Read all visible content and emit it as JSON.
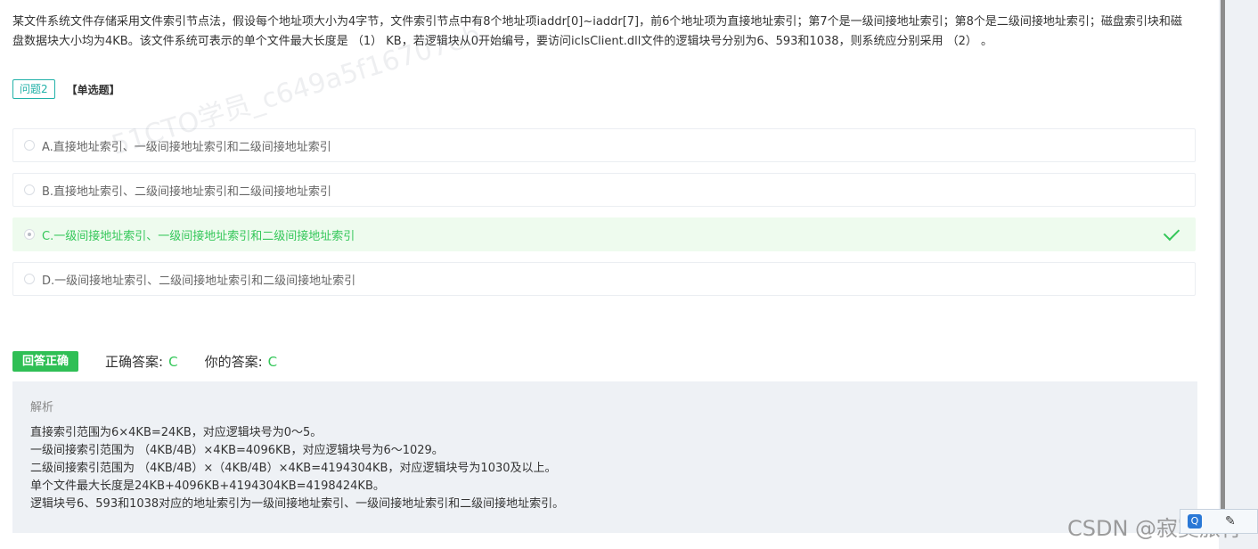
{
  "question": {
    "text": "某文件系统文件存储采用文件索引节点法，假设每个地址项大小为4字节，文件索引节点中有8个地址项iaddr[0]~iaddr[7]，前6个地址项为直接地址索引；第7个是一级间接地址索引；第8个是二级间接地址索引；磁盘索引块和磁盘数据块大小均为4KB。该文件系统可表示的单个文件最大长度是 （1） KB，若逻辑块从0开始编号，要访问iclsClient.dll文件的逻辑块号分别为6、593和1038，则系统应分别采用 （2） 。",
    "tag": "问题2",
    "type": "【单选题】"
  },
  "options": [
    {
      "label": "A.直接地址索引、一级间接地址索引和二级间接地址索引",
      "correct": false
    },
    {
      "label": "B.直接地址索引、二级间接地址索引和二级间接地址索引",
      "correct": false
    },
    {
      "label": "C.一级间接地址索引、一级间接地址索引和二级间接地址索引",
      "correct": true
    },
    {
      "label": "D.一级间接地址索引、二级间接地址索引和二级间接地址索引",
      "correct": false
    }
  ],
  "watermark": "51CTO学员_c649a5f16707eb",
  "result": {
    "badge": "回答正确",
    "correct_label": "正确答案:",
    "correct_value": "C",
    "your_label": "你的答案:",
    "your_value": "C"
  },
  "analysis": {
    "title": "解析",
    "lines": [
      "直接索引范围为6×4KB=24KB，对应逻辑块号为0～5。",
      "一级间接索引范围为 （4KB/4B）×4KB=4096KB，对应逻辑块号为6～1029。",
      "二级间接索引范围为 （4KB/4B）×（4KB/4B）×4KB=4194304KB，对应逻辑块号为1030及以上。",
      "单个文件最大长度是24KB+4096KB+4194304KB=4198424KB。",
      "逻辑块号6、593和1038对应的地址索引为一级间接地址索引、一级间接地址索引和二级间接地址索引。"
    ]
  },
  "overlay": {
    "csdn": "CSDN @寂寞旅行",
    "widget_icon": "Q",
    "widget_pen": "✎"
  },
  "colors": {
    "accent_teal": "#21b1a8",
    "correct_green": "#34c759",
    "correct_bg": "#eefbee",
    "badge_green": "#2fbf55",
    "analysis_bg": "#eef1f5"
  }
}
